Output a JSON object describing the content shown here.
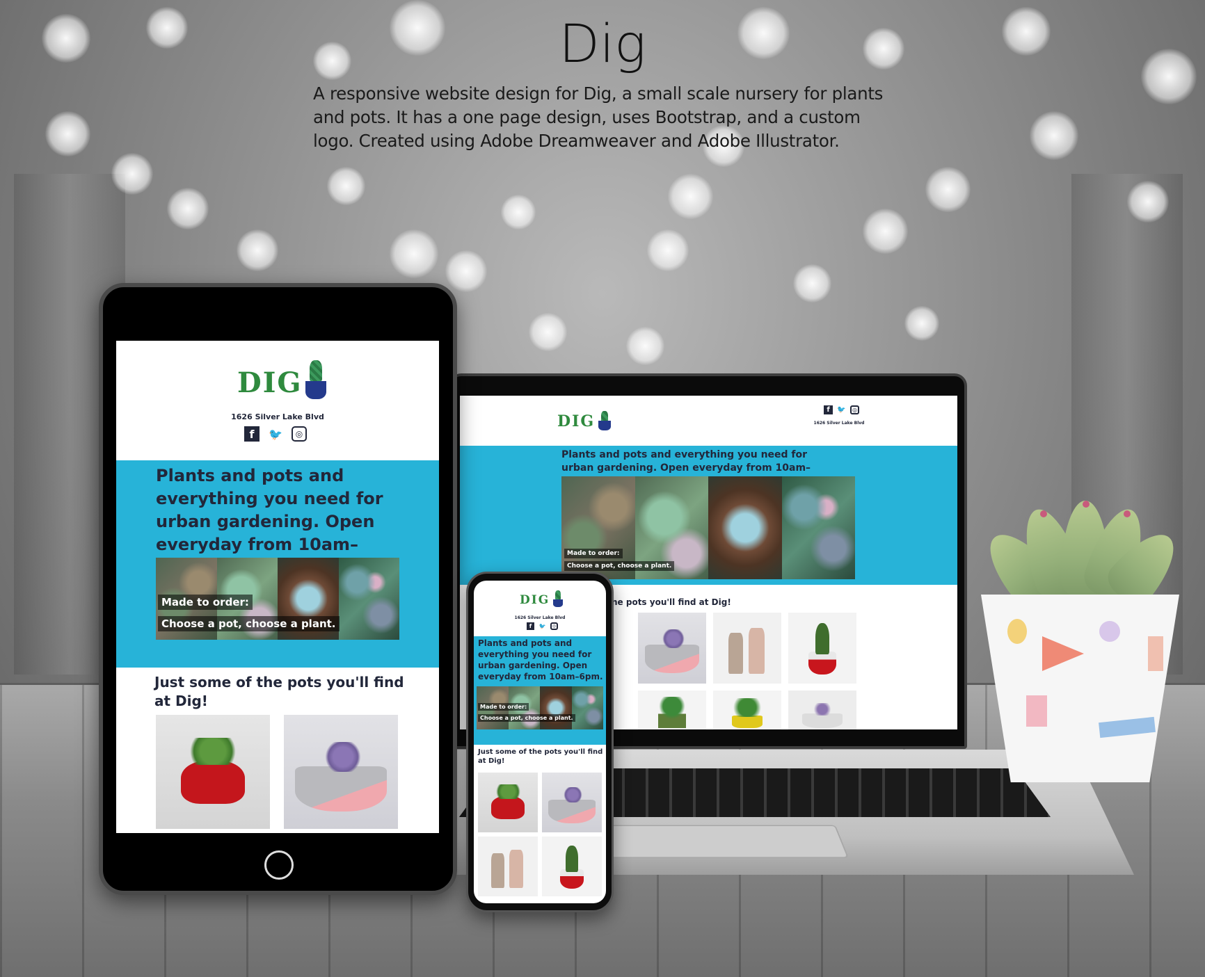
{
  "hero": {
    "title": "Dig",
    "description": "A responsive website design for Dig, a small scale nursery for plants and pots. It has a one page design, uses Bootstrap, and a custom logo. Created using Adobe Dreamweaver and Adobe Illustrator."
  },
  "site": {
    "logo": "DIG",
    "address": "1626 Silver Lake Blvd",
    "social": {
      "facebook": "f",
      "twitter": "🐦",
      "instagram": "◎"
    },
    "banner_text": "Plants and pots and everything you need for urban gardening. Open everyday from 10am–6pm.",
    "caption_line1": "Made to order:",
    "caption_line2": "Choose a pot, choose a plant.",
    "section_title": "Just some of the pots you'll find at Dig!",
    "laptop_section_title_partial": "ne pots you'll find at Dig!"
  },
  "icons": {
    "facebook": "facebook-icon",
    "twitter": "twitter-icon",
    "instagram": "instagram-icon",
    "home": "home-button-icon"
  },
  "colors": {
    "banner": "#27b3d8",
    "logo_green": "#2f8a3e",
    "pot_blue": "#243a8c",
    "text_dark": "#22273a"
  }
}
